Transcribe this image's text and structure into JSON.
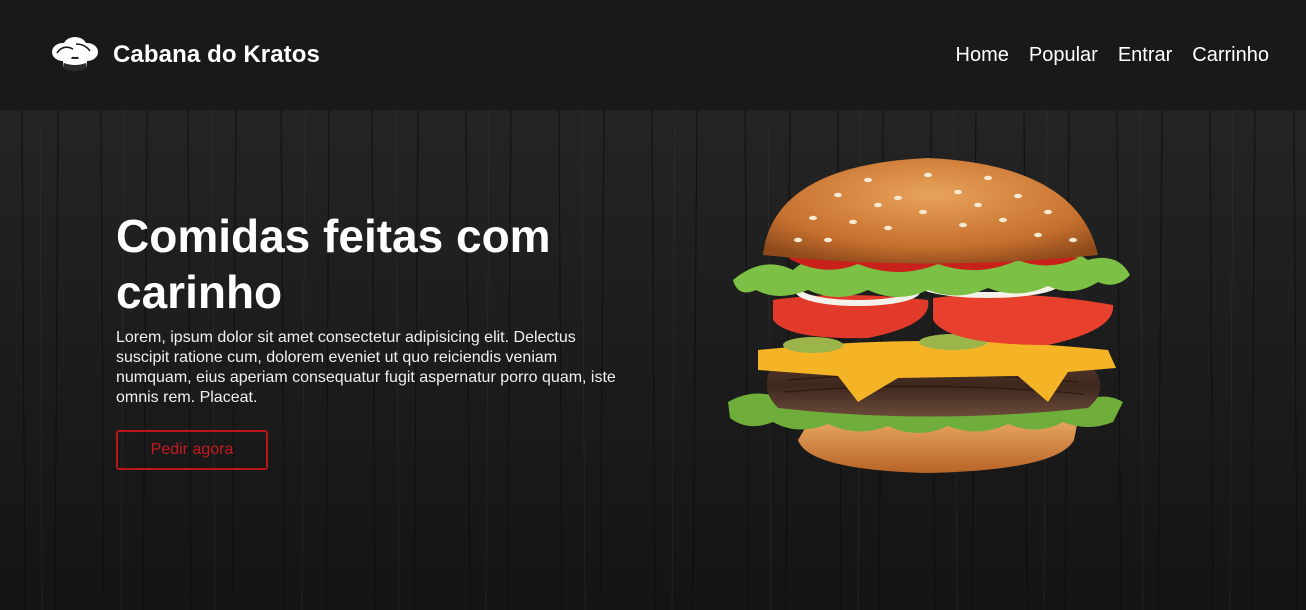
{
  "header": {
    "brand_name": "Cabana do Kratos",
    "logo_icon": "chef-hat-icon",
    "nav": [
      {
        "label": "Home"
      },
      {
        "label": "Popular"
      },
      {
        "label": "Entrar"
      },
      {
        "label": "Carrinho"
      }
    ]
  },
  "hero": {
    "title": "Comidas feitas com carinho",
    "text": "Lorem, ipsum dolor sit amet consectetur adipisicing elit. Delectus suscipit ratione cum, dolorem eveniet ut quo reiciendis veniam numquam, eius aperiam consequatur fugit aspernatur porro quam, iste omnis rem. Placeat.",
    "cta_label": "Pedir agora",
    "image": "hamburger-illustration"
  },
  "colors": {
    "background": "#141414",
    "header": "#191919",
    "accent": "#c4191d",
    "text": "#ffffff"
  }
}
